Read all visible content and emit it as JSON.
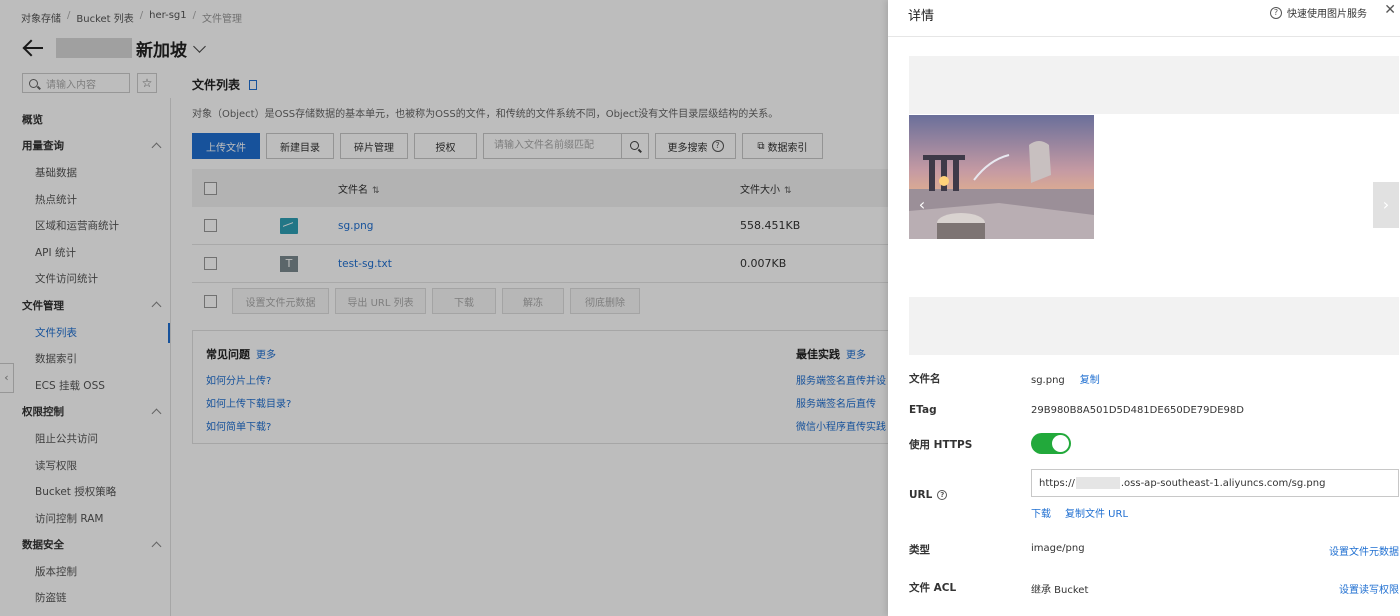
{
  "breadcrumb": [
    "对象存储",
    "Bucket 列表",
    "her-sg1",
    "文件管理"
  ],
  "header": {
    "region": "新加坡"
  },
  "sidebar": {
    "search_placeholder": "请输入内容",
    "items": [
      {
        "label": "概览",
        "type": "group"
      },
      {
        "label": "用量查询",
        "type": "group",
        "expanded": true
      },
      {
        "label": "基础数据",
        "type": "sub"
      },
      {
        "label": "热点统计",
        "type": "sub"
      },
      {
        "label": "区域和运营商统计",
        "type": "sub"
      },
      {
        "label": "API 统计",
        "type": "sub"
      },
      {
        "label": "文件访问统计",
        "type": "sub"
      },
      {
        "label": "文件管理",
        "type": "group",
        "expanded": true
      },
      {
        "label": "文件列表",
        "type": "sub",
        "active": true
      },
      {
        "label": "数据索引",
        "type": "sub"
      },
      {
        "label": "ECS 挂载 OSS",
        "type": "sub"
      },
      {
        "label": "权限控制",
        "type": "group",
        "expanded": true
      },
      {
        "label": "阻止公共访问",
        "type": "sub"
      },
      {
        "label": "读写权限",
        "type": "sub"
      },
      {
        "label": "Bucket 授权策略",
        "type": "sub"
      },
      {
        "label": "访问控制 RAM",
        "type": "sub"
      },
      {
        "label": "数据安全",
        "type": "group",
        "expanded": true
      },
      {
        "label": "版本控制",
        "type": "sub"
      },
      {
        "label": "防盗链",
        "type": "sub"
      }
    ]
  },
  "main": {
    "title": "文件列表",
    "description": "对象（Object）是OSS存储数据的基本单元，也被称为OSS的文件，和传统的文件系统不同，Object没有文件目录层级结构的关系。",
    "toolbar": {
      "upload": "上传文件",
      "new_dir": "新建目录",
      "fragments": "碎片管理",
      "authorize": "授权",
      "search_placeholder": "请输入文件名前缀匹配",
      "more_search": "更多搜索",
      "data_index": "数据索引"
    },
    "table": {
      "col_name": "文件名",
      "col_size": "文件大小",
      "rows": [
        {
          "name": "sg.png",
          "size": "558.451KB",
          "kind": "image"
        },
        {
          "name": "test-sg.txt",
          "size": "0.007KB",
          "kind": "text",
          "icon_letter": "T"
        }
      ]
    },
    "bulk": {
      "set_meta": "设置文件元数据",
      "export_url": "导出 URL 列表",
      "download": "下载",
      "unfreeze": "解冻",
      "delete": "彻底删除"
    },
    "faq": {
      "title": "常见问题",
      "more": "更多",
      "links": [
        "如何分片上传?",
        "如何上传下载目录?",
        "如何简单下载?"
      ]
    },
    "best": {
      "title": "最佳实践",
      "more": "更多",
      "links": [
        "服务端签名直传并设",
        "服务端签名后直传",
        "微信小程序直传实践"
      ]
    }
  },
  "drawer": {
    "title": "详情",
    "help_link": "快速使用图片服务",
    "fields": {
      "filename_label": "文件名",
      "filename": "sg.png",
      "copy": "复制",
      "etag_label": "ETag",
      "etag": "29B980B8A501D5D481DE650DE79DE98D",
      "https_label": "使用 HTTPS",
      "https_enabled": true,
      "url_label": "URL",
      "url_prefix": "https://",
      "url_suffix": ".oss-ap-southeast-1.aliyuncs.com/sg.png",
      "download": "下载",
      "copy_url": "复制文件 URL",
      "type_label": "类型",
      "type": "image/png",
      "set_meta": "设置文件元数据",
      "acl_label": "文件 ACL",
      "acl": "继承 Bucket",
      "set_acl": "设置读写权限"
    }
  },
  "colors": {
    "primary": "#1f6fd1",
    "toggle_on": "#22a93b"
  }
}
